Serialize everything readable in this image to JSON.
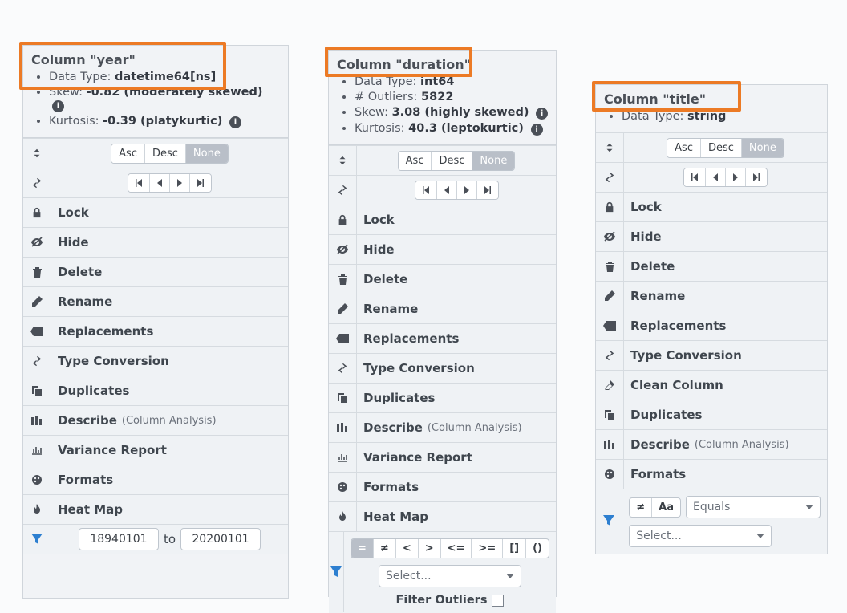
{
  "common": {
    "sort_asc": "Asc",
    "sort_desc": "Desc",
    "sort_none": "None",
    "lock": "Lock",
    "hide": "Hide",
    "delete": "Delete",
    "rename": "Rename",
    "replacements": "Replacements",
    "type_conv": "Type Conversion",
    "duplicates": "Duplicates",
    "describe": "Describe",
    "describe_sub": "(Column Analysis)",
    "variance": "Variance Report",
    "formats": "Formats",
    "heatmap": "Heat Map",
    "clean_column": "Clean Column",
    "select_placeholder": "Select...",
    "to": "to",
    "op_eq": "=",
    "op_ne": "≠",
    "op_lt": "<",
    "op_gt": ">",
    "op_le": "<=",
    "op_ge": ">=",
    "op_in": "[]",
    "op_paren": "()",
    "op_aa": "Aa",
    "comp_equals": "Equals",
    "filter_outliers": "Filter Outliers"
  },
  "panels": {
    "year": {
      "title": "Column \"year\"",
      "dtype_label": "Data Type:",
      "dtype_val": "datetime64[ns]",
      "skew_label": "Skew:",
      "skew_val": "-0.82 (moderately skewed)",
      "kurt_label": "Kurtosis:",
      "kurt_val": "-0.39 (platykurtic)",
      "range_from": "18940101",
      "range_to": "20200101"
    },
    "duration": {
      "title": "Column \"duration\"",
      "dtype_label": "Data Type:",
      "dtype_val": "int64",
      "outliers_label": "# Outliers:",
      "outliers_val": "5822",
      "skew_label": "Skew:",
      "skew_val": "3.08 (highly skewed)",
      "kurt_label": "Kurtosis:",
      "kurt_val": "40.3 (leptokurtic)"
    },
    "title": {
      "title": "Column \"title\"",
      "dtype_label": "Data Type:",
      "dtype_val": "string"
    }
  }
}
